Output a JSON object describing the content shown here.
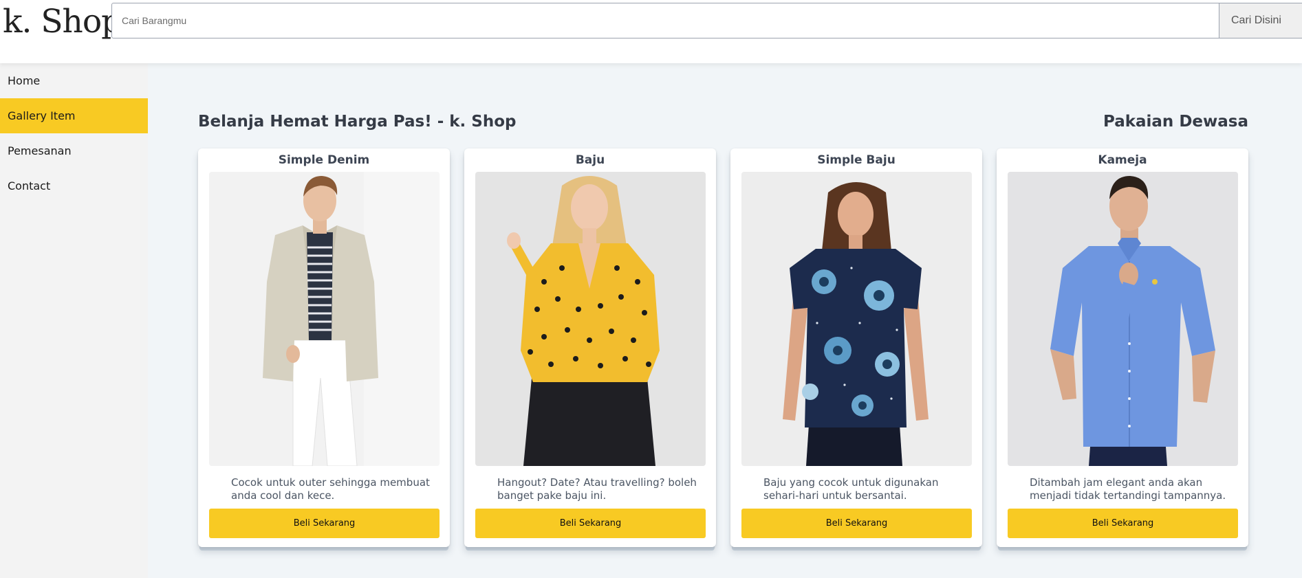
{
  "header": {
    "logo": "k. Shop",
    "search_placeholder": "Cari Barangmu",
    "search_button": "Cari Disini"
  },
  "sidebar": {
    "items": [
      {
        "label": "Home",
        "active": false
      },
      {
        "label": "Gallery Item",
        "active": true
      },
      {
        "label": "Pemesanan",
        "active": false
      },
      {
        "label": "Contact",
        "active": false
      }
    ]
  },
  "main": {
    "title": "Belanja Hemat Harga Pas! - k. Shop",
    "section_title": "Pakaian Dewasa",
    "products": [
      {
        "name": "Simple Denim",
        "description": "Cocok untuk outer sehingga membuat anda cool dan kece.",
        "button": "Beli Sekarang",
        "image_icon": "man-in-beige-blazer-photo"
      },
      {
        "name": "Baju",
        "description": "Hangout? Date? Atau travelling? boleh banget pake baju ini.",
        "button": "Beli Sekarang",
        "image_icon": "woman-in-yellow-polka-dot-blouse-photo"
      },
      {
        "name": "Simple Baju",
        "description": "Baju yang cocok untuk digunakan sehari-hari untuk bersantai.",
        "button": "Beli Sekarang",
        "image_icon": "woman-in-floral-navy-tshirt-photo"
      },
      {
        "name": "Kameja",
        "description": "Ditambah jam elegant anda akan menjadi tidak tertandingi tampannya.",
        "button": "Beli Sekarang",
        "image_icon": "man-in-blue-shirt-photo"
      }
    ]
  },
  "colors": {
    "accent": "#f8ca23",
    "main_background": "#f1f5f8",
    "sidebar_background": "#f3f3f3",
    "heading": "#353b46"
  }
}
